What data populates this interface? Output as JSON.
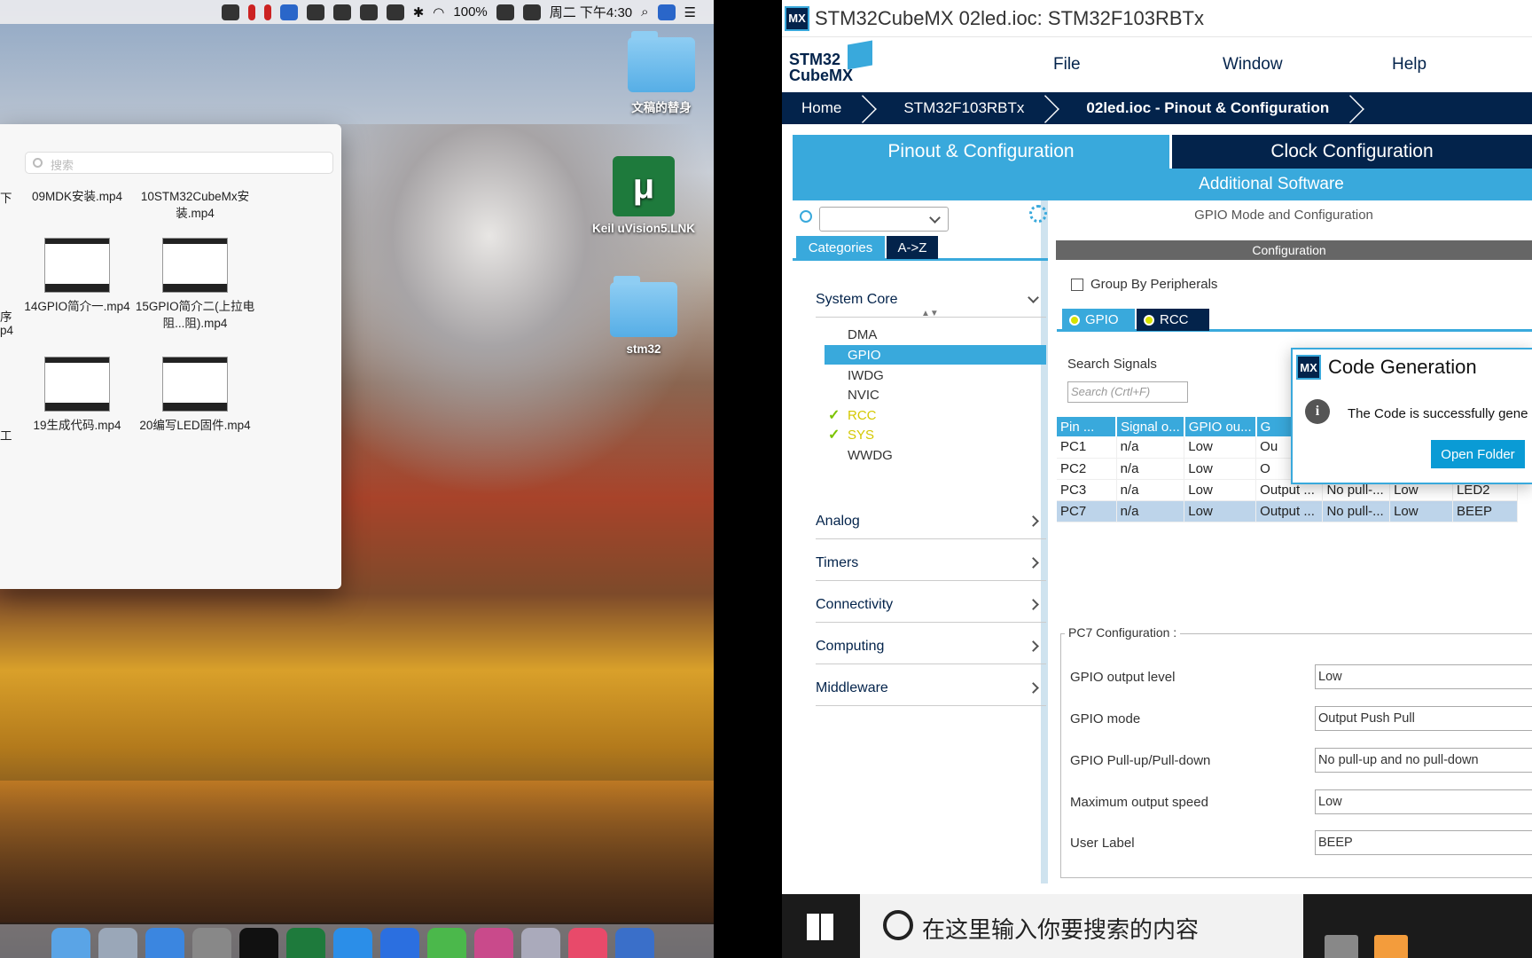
{
  "mac": {
    "menubar": {
      "battery": "100%",
      "clock": "周二 下午4:30"
    },
    "finder": {
      "search_placeholder": "搜索",
      "partial_left": [
        "下",
        "序",
        "p4",
        "工"
      ],
      "files": [
        {
          "name": "09MDK安装.mp4",
          "thumb": false
        },
        {
          "name": "10STM32CubeMx安装.mp4",
          "thumb": false
        },
        {
          "name": "14GPIO简介一.mp4",
          "thumb": true
        },
        {
          "name": "15GPIO简介二(上拉电阻...阻).mp4",
          "thumb": true
        },
        {
          "name": "19生成代码.mp4",
          "thumb": true
        },
        {
          "name": "20编写LED固件.mp4",
          "thumb": true
        }
      ]
    },
    "desktop_icons": [
      {
        "label": "文稿的替身",
        "icon": "folder-alias-icon"
      },
      {
        "label": "Keil uVision5.LNK",
        "icon": "keil-icon"
      },
      {
        "label": "stm32",
        "icon": "folder-icon"
      }
    ],
    "keil_glyph": "μ"
  },
  "cubemx": {
    "badge": "MX",
    "window_title": "STM32CubeMX 02led.ioc: STM32F103RBTx",
    "logo": {
      "line1": "STM32",
      "line2": "CubeMX"
    },
    "menu": [
      "File",
      "Window",
      "Help"
    ],
    "breadcrumb": [
      "Home",
      "STM32F103RBTx",
      "02led.ioc - Pinout & Configuration"
    ],
    "tabs": {
      "pinout": "Pinout & Configuration",
      "clock": "Clock Configuration",
      "additional": "Additional Software"
    },
    "left": {
      "category_tabs": [
        "Categories",
        "A->Z"
      ],
      "system_core": "System Core",
      "peripherals": [
        {
          "name": "DMA",
          "state": "normal"
        },
        {
          "name": "GPIO",
          "state": "selected"
        },
        {
          "name": "IWDG",
          "state": "normal"
        },
        {
          "name": "NVIC",
          "state": "normal"
        },
        {
          "name": "RCC",
          "state": "ok"
        },
        {
          "name": "SYS",
          "state": "ok"
        },
        {
          "name": "WWDG",
          "state": "normal"
        }
      ],
      "sections": [
        "Analog",
        "Timers",
        "Connectivity",
        "Computing",
        "Middleware"
      ]
    },
    "right": {
      "mode_title": "GPIO Mode and Configuration",
      "config_bar": "Configuration",
      "group_by": "Group By Peripherals",
      "ptabs": [
        "GPIO",
        "RCC"
      ],
      "search_label": "Search Signals",
      "search_placeholder": "Search (Crtl+F)",
      "columns": [
        "Pin ...",
        "Signal o...",
        "GPIO ou...",
        "G",
        "",
        "",
        ""
      ],
      "rows": [
        [
          "PC1",
          "n/a",
          "Low",
          "Ou",
          "",
          "",
          ""
        ],
        [
          "PC2",
          "n/a",
          "Low",
          "O",
          "",
          "",
          ""
        ],
        [
          "PC3",
          "n/a",
          "Low",
          "Output ...",
          "No pull-...",
          "Low",
          "LED2"
        ],
        [
          "PC7",
          "n/a",
          "Low",
          "Output ...",
          "No pull-...",
          "Low",
          "BEEP"
        ]
      ],
      "pc7": {
        "legend": "PC7 Configuration :",
        "fields": [
          {
            "label": "GPIO output level",
            "value": "Low"
          },
          {
            "label": "GPIO mode",
            "value": "Output Push Pull"
          },
          {
            "label": "GPIO Pull-up/Pull-down",
            "value": "No pull-up and no pull-down"
          },
          {
            "label": "Maximum output speed",
            "value": "Low"
          },
          {
            "label": "User Label",
            "value": "BEEP"
          }
        ]
      }
    },
    "dialog": {
      "title": "Code Generation",
      "message": "The Code is successfully gene",
      "button": "Open Folder"
    }
  },
  "windows_taskbar": {
    "search_text": "在这里输入你要搜索的内容"
  }
}
